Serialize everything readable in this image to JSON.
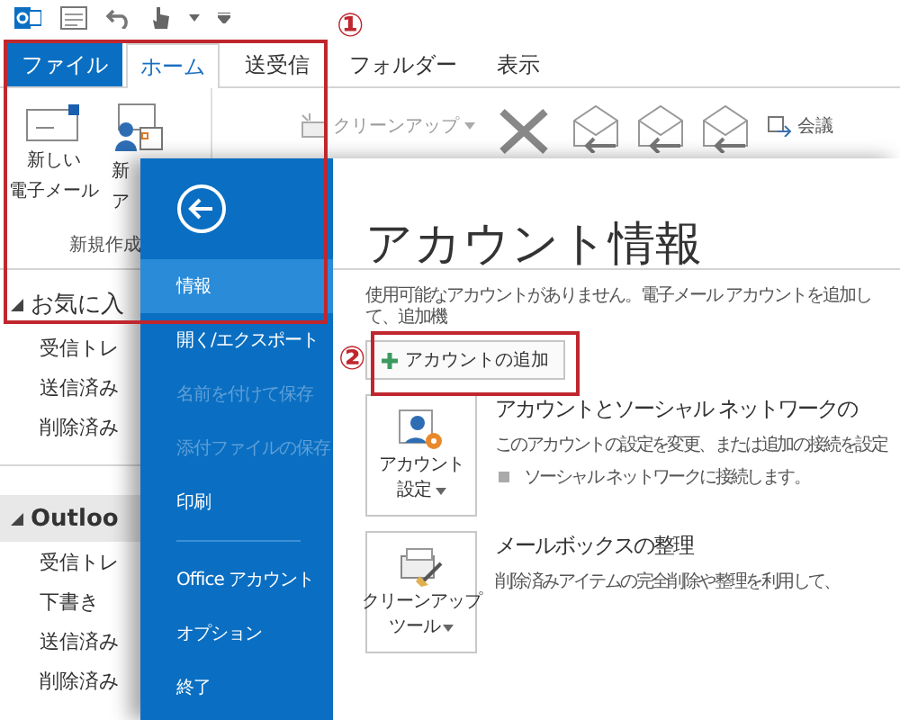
{
  "tabs": [
    {
      "label": "ファイル",
      "kind": "file",
      "selected": false
    },
    {
      "label": "ホーム",
      "kind": "tab",
      "selected": true
    },
    {
      "label": "送受信",
      "kind": "tab",
      "selected": false
    },
    {
      "label": "フォルダー",
      "kind": "tab",
      "selected": false
    },
    {
      "label": "表示",
      "kind": "tab",
      "selected": false
    }
  ],
  "ribbon": {
    "new_mail": [
      "新しい",
      "電子メール"
    ],
    "new_item": [
      "新",
      "ア"
    ],
    "group_label": "新規作成",
    "cleanup": "クリーンアップ",
    "meeting": "会議"
  },
  "folder_pane": {
    "sections": [
      {
        "title": "お気に入",
        "expanded": true,
        "items": [
          "受信トレ",
          "送信済み",
          "削除済み"
        ]
      },
      {
        "title": "Outloo",
        "expanded": true,
        "items": [
          "受信トレ",
          "下書き",
          "送信済み",
          "削除済み"
        ]
      }
    ]
  },
  "backstage": {
    "menu_groups": [
      [
        {
          "label": "情報",
          "selected": true,
          "disabled": false
        },
        {
          "label": "開く/エクスポート",
          "selected": false,
          "disabled": false
        },
        {
          "label": "名前を付けて保存",
          "selected": false,
          "disabled": true
        },
        {
          "label": "添付ファイルの保存",
          "selected": false,
          "disabled": true
        },
        {
          "label": "印刷",
          "selected": false,
          "disabled": false
        }
      ],
      [
        {
          "label": "Office アカウント",
          "selected": false,
          "disabled": false
        },
        {
          "label": "オプション",
          "selected": false,
          "disabled": false
        },
        {
          "label": "終了",
          "selected": false,
          "disabled": false
        }
      ]
    ],
    "title": "アカウント情報",
    "description": "使用可能なアカウントがありません。電子メール アカウントを追加して、追加機",
    "add_account": "アカウントの追加",
    "sections": [
      {
        "kind": "account",
        "tile": [
          "アカウント",
          "設定"
        ],
        "heading": "アカウントとソーシャル ネットワークの",
        "description": "このアカウントの設定を変更、または追加の接続を設定",
        "bullet": "ソーシャル ネットワークに接続します。"
      },
      {
        "kind": "cleanup",
        "tile": [
          "クリーンアップ",
          "ツール"
        ],
        "heading": "メールボックスの整理",
        "description": "削除済みアイテムの完全削除や整理を利用して、"
      }
    ]
  },
  "annotations": [
    "①",
    "②"
  ]
}
